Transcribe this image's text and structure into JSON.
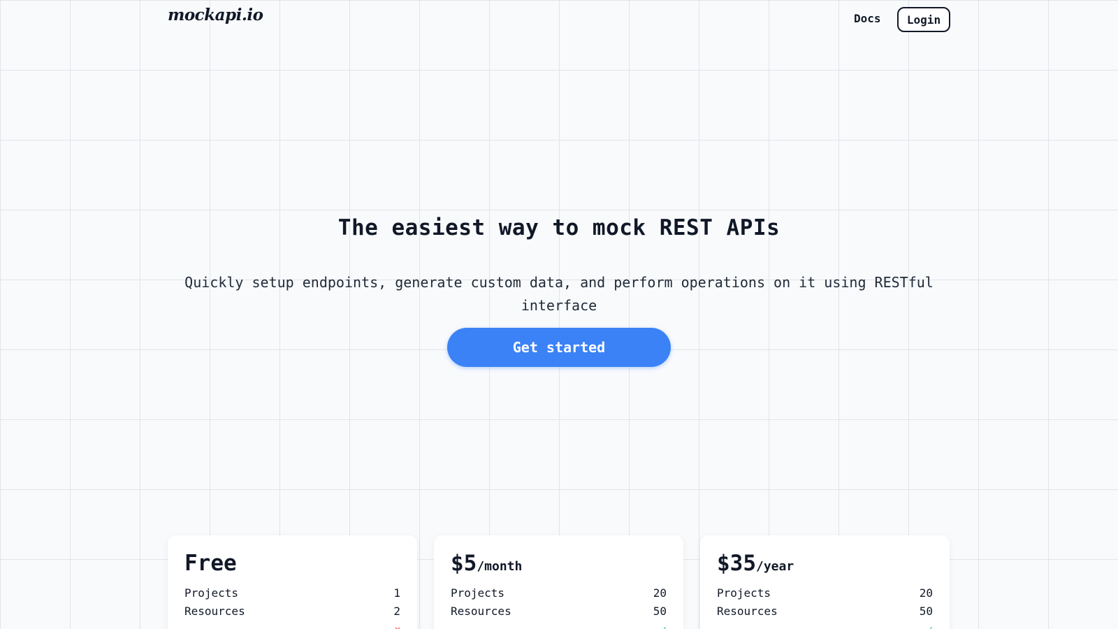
{
  "header": {
    "logo": "mockapi.io",
    "nav": {
      "docs": "Docs",
      "login": "Login"
    }
  },
  "hero": {
    "title": "The easiest way to mock REST APIs",
    "subtitle": "Quickly setup endpoints, generate custom data, and perform operations on it using RESTful interface",
    "cta": "Get started"
  },
  "plans": [
    {
      "price": "Free",
      "period": "",
      "rows": [
        {
          "label": "Projects",
          "value": "1"
        },
        {
          "label": "Resources",
          "value": "2"
        }
      ]
    },
    {
      "price": "$5",
      "period": "/month",
      "rows": [
        {
          "label": "Projects",
          "value": "20"
        },
        {
          "label": "Resources",
          "value": "50"
        }
      ]
    },
    {
      "price": "$35",
      "period": "/year",
      "rows": [
        {
          "label": "Projects",
          "value": "20"
        },
        {
          "label": "Resources",
          "value": "50"
        }
      ]
    }
  ],
  "colors": {
    "accent": "#3b82f6",
    "text": "#111827",
    "background": "#f8fafc"
  }
}
